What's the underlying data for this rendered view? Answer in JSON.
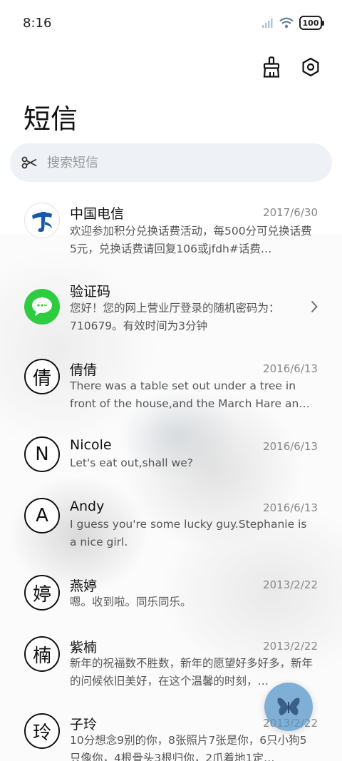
{
  "status_bar": {
    "time": "8:16",
    "battery": "100",
    "icons": [
      "signal-icon",
      "wifi-icon",
      "battery-icon"
    ]
  },
  "toolbar": {
    "icons": [
      "broom-icon",
      "settings-icon"
    ]
  },
  "header": {
    "title": "短信"
  },
  "search": {
    "placeholder": "搜索短信",
    "icon": "scissors-icon"
  },
  "conversations": [
    {
      "name": "中国电信",
      "date": "2017/6/30",
      "preview": "欢迎参加积分兑换话费活动，每500分可兑换话费5元，兑换话费请回复106或jfdh#话费…",
      "avatar": "china-telecom-logo"
    },
    {
      "name": "验证码",
      "date": "",
      "preview": "您好！您的网上营业厅登录的随机密码为：710679。有效时间为3分钟",
      "avatar": "message-icon",
      "accent": "#2ecc40"
    },
    {
      "name": "倩倩",
      "date": "2016/6/13",
      "preview": "There was a table set out under a tree in front of the house,and the March Hare an…",
      "avatar_text": "倩"
    },
    {
      "name": "Nicole",
      "date": "2016/6/13",
      "preview": "Let's eat out,shall we?",
      "avatar_text": "N"
    },
    {
      "name": "Andy",
      "date": "2016/6/13",
      "preview": "I guess you're some lucky guy.Stephanie is a nice girl.",
      "avatar_text": "A"
    },
    {
      "name": "燕婷",
      "date": "2013/2/22",
      "preview": "嗯。收到啦。同乐同乐。",
      "avatar_text": "婷"
    },
    {
      "name": "紫楠",
      "date": "2013/2/22",
      "preview": "新年的祝福数不胜数，新年的愿望好多好多，新年的问候依旧美好，在这个温馨的时刻，…",
      "avatar_text": "楠"
    },
    {
      "name": "子玲",
      "date": "2013/2/22",
      "preview": "10分想念9别的你，8张照片7张是你，6只小狗5只像你，4根骨头3根归你，2爪着地1定…",
      "avatar_text": "玲"
    }
  ],
  "fab": {
    "icon": "butterfly-icon",
    "color": "#5596c8"
  }
}
